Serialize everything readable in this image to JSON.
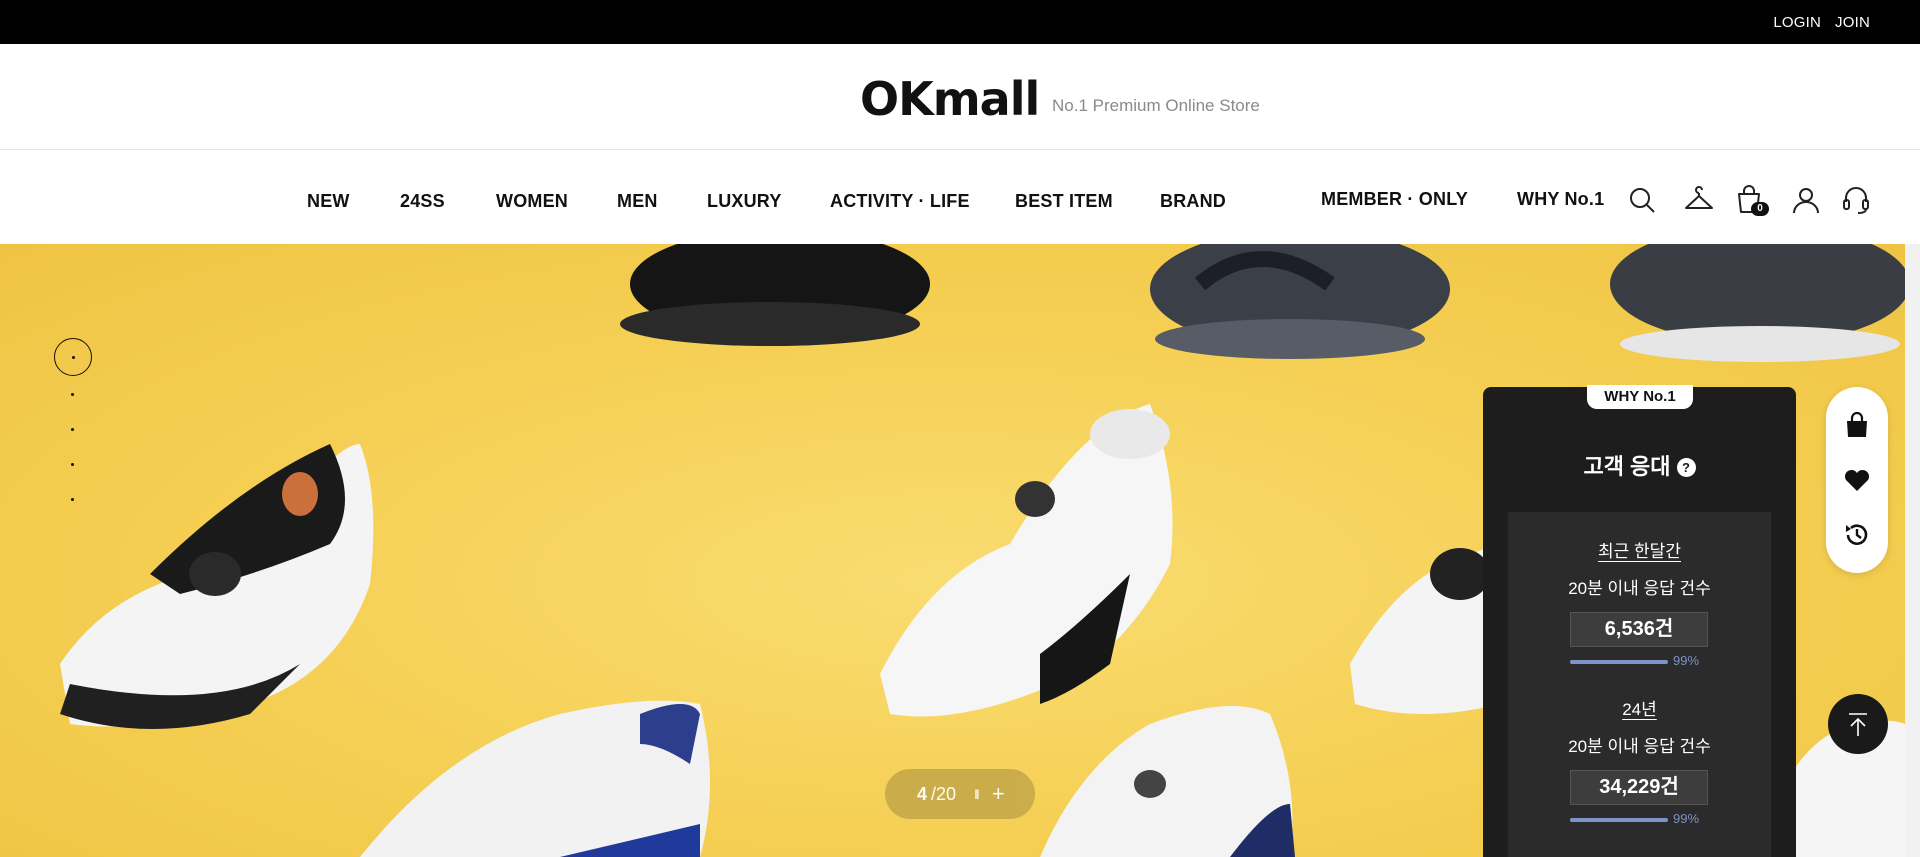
{
  "topbar": {
    "login": "LOGIN",
    "join": "JOIN"
  },
  "brand": {
    "logo": "OKmall",
    "tagline": "No.1 Premium Online Store"
  },
  "nav": {
    "items": [
      "NEW",
      "24SS",
      "WOMEN",
      "MEN",
      "LUXURY",
      "ACTIVITY · LIFE",
      "BEST ITEM",
      "BRAND"
    ],
    "member_only": "MEMBER · ONLY",
    "why": "WHY No.1",
    "cart_count": "0"
  },
  "hero": {
    "background_color": "#f5cf53",
    "slide_current": "4",
    "slide_total": "/20",
    "pause_symbol": "II",
    "plus_symbol": "+"
  },
  "why_panel": {
    "badge": "WHY No.1",
    "title": "고객 응대",
    "help_symbol": "?",
    "stats": [
      {
        "period": "최근 한달간",
        "label": "20분 이내 응답 건수",
        "value": "6,536건",
        "percent": "99%"
      },
      {
        "period": "24년",
        "label": "20분 이내 응답 건수",
        "value": "34,229건",
        "percent": "99%"
      }
    ]
  }
}
